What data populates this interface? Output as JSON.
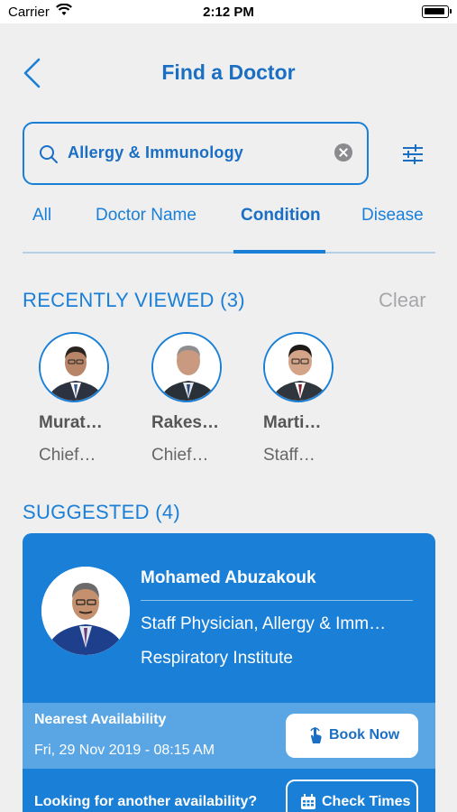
{
  "status_bar": {
    "carrier": "Carrier",
    "time": "2:12 PM"
  },
  "header": {
    "title": "Find a Doctor",
    "back_icon": "chevron-left-icon",
    "filter_icon": "sliders-icon"
  },
  "search": {
    "value": "Allergy & Immunology",
    "icon": "search-icon",
    "clear_icon": "clear-icon"
  },
  "tabs": [
    {
      "label": "All",
      "active": false
    },
    {
      "label": "Doctor Name",
      "active": false
    },
    {
      "label": "Condition",
      "active": true
    },
    {
      "label": "Disease",
      "active": false
    }
  ],
  "recently_viewed": {
    "title": "RECENTLY VIEWED (3)",
    "clear_label": "Clear",
    "doctors": [
      {
        "name": "Murat…",
        "title": "Chief…"
      },
      {
        "name": "Rakes…",
        "title": "Chief…"
      },
      {
        "name": "Marti…",
        "title": "Staff…"
      }
    ]
  },
  "suggested": {
    "title": "SUGGESTED (4)",
    "card": {
      "name": "Mohamed Abuzakouk",
      "title": "Staff Physician, Allergy & Imm…",
      "institute": "Respiratory Institute",
      "availability_label": "Nearest Availability",
      "availability_time": "Fri, 29 Nov 2019 - 08:15 AM",
      "book_label": "Book Now",
      "another_label": "Looking for another availability?",
      "check_label": "Check Times"
    }
  },
  "colors": {
    "accent": "#1a7fd6",
    "card_bg": "#1a7fd6",
    "availability_bg": "#5aa6e4",
    "page_bg": "#efeff0"
  }
}
